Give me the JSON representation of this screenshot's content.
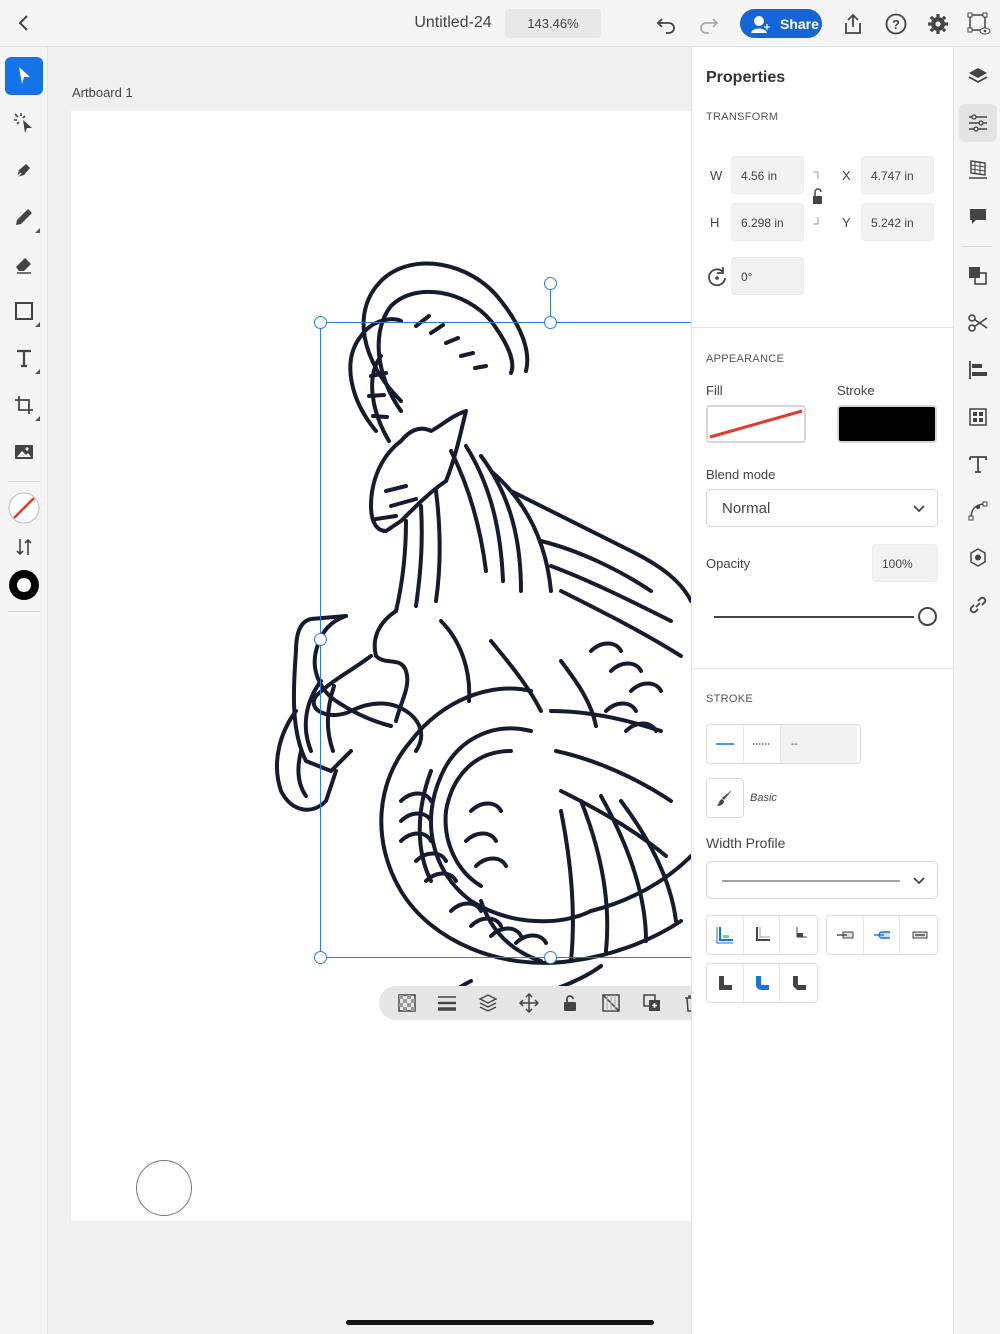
{
  "app": {
    "document_title": "Untitled-24",
    "zoom_level": "143.46%",
    "share_label": "Share",
    "accent_color": "#1473e6"
  },
  "canvas": {
    "artboard_label": "Artboard 1"
  },
  "properties": {
    "title": "Properties",
    "transform": {
      "section_label": "TRANSFORM",
      "w_label": "W",
      "w_value": "4.56 in",
      "h_label": "H",
      "h_value": "6.298 in",
      "x_label": "X",
      "x_value": "4.747 in",
      "y_label": "Y",
      "y_value": "5.242 in",
      "rotation_value": "0°"
    },
    "appearance": {
      "section_label": "APPEARANCE",
      "fill_label": "Fill",
      "fill_color": "none",
      "stroke_label": "Stroke",
      "stroke_color": "#000000",
      "blend_mode_label": "Blend mode",
      "blend_mode_value": "Normal",
      "opacity_label": "Opacity",
      "opacity_value": "100%",
      "opacity_fraction": 1.0
    },
    "stroke": {
      "section_label": "STROKE",
      "dash_option_label": "--",
      "brush_label": "Basic",
      "width_profile_label": "Width Profile"
    }
  }
}
